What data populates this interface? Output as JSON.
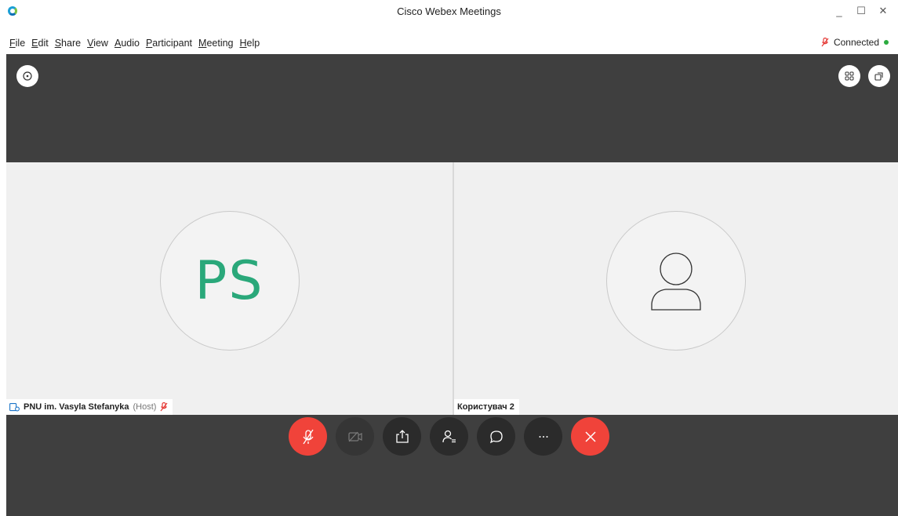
{
  "window": {
    "title": "Cisco Webex Meetings",
    "minimize_label": "_",
    "maximize_label": "☐",
    "close_label": "✕"
  },
  "menu": [
    {
      "key": "F",
      "rest": "ile"
    },
    {
      "key": "E",
      "rest": "dit"
    },
    {
      "key": "S",
      "rest": "hare"
    },
    {
      "key": "V",
      "rest": "iew"
    },
    {
      "key": "A",
      "rest": "udio"
    },
    {
      "key": "P",
      "rest": "articipant"
    },
    {
      "key": "M",
      "rest": "eeting"
    },
    {
      "key": "H",
      "rest": "elp"
    }
  ],
  "status": {
    "text": "Connected",
    "dot_color": "#2bab3f"
  },
  "participants": [
    {
      "initials": "PS",
      "name": "PNU im. Vasyla Stefanyka",
      "role": "(Host)",
      "muted": true
    },
    {
      "initials": "",
      "name": "Користувач 2",
      "role": "",
      "muted": false
    }
  ],
  "colors": {
    "accent_red": "#f0433a",
    "initials_green": "#2aa87a",
    "stage_bg": "#3f3f3f"
  },
  "icons": {
    "top_left": "info-icon",
    "top_right_1": "grid-layout-icon",
    "top_right_2": "popout-icon",
    "controls": [
      "mic-muted-icon",
      "video-off-icon",
      "share-icon",
      "participants-icon",
      "chat-icon",
      "more-icon",
      "end-meeting-icon"
    ]
  }
}
